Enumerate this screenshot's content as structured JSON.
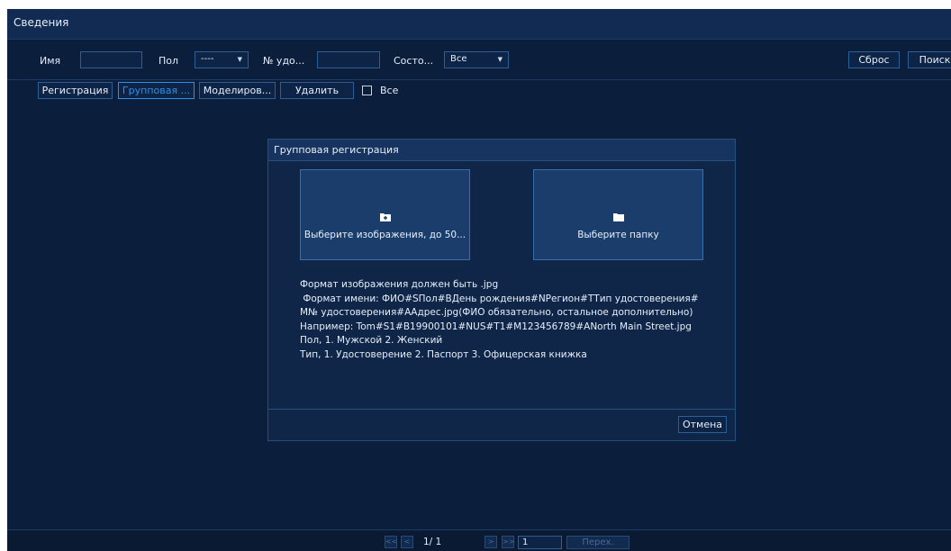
{
  "window": {
    "title": "Сведения"
  },
  "filters": {
    "name_label": "Имя",
    "name_value": "",
    "gender_label": "Пол",
    "gender_value": "----",
    "id_label": "№ удо...",
    "id_value": "",
    "status_label": "Состо...",
    "status_value": "Все",
    "reset_label": "Сброс",
    "search_label": "Поиск"
  },
  "toolbar": {
    "register_label": "Регистрация",
    "batch_label": "Групповая ...",
    "modeling_label": "Моделиров...",
    "delete_label": "Удалить",
    "all_label": "Все"
  },
  "dialog": {
    "title": "Групповая регистрация",
    "select_images_label": "Выберите изображения, до 50...",
    "select_folder_label": "Выберите папку",
    "info_lines": [
      "Формат изображения должен быть .jpg",
      " Формат имени: ФИО#SПол#BДень рождения#NРегион#TТип удостоверения#",
      "M№ удостоверения#AАдрес.jpg(ФИО обязательно, остальное дополнительно)",
      "Например: Tom#S1#B19900101#NUS#T1#M123456789#ANorth Main Street.jpg",
      "Пол, 1. Мужской 2. Женский",
      "Тип, 1. Удостоверение 2. Паспорт 3. Офицерская книжка"
    ],
    "cancel_label": "Отмена"
  },
  "pager": {
    "first": "<<",
    "prev": "<",
    "page_info": "1/ 1",
    "next": ">",
    "last": ">>",
    "goto_value": "1",
    "go_label": "Перех."
  },
  "colors": {
    "background": "#0b1e3c",
    "accent": "#2f8fe6",
    "border": "#2a5f98"
  }
}
